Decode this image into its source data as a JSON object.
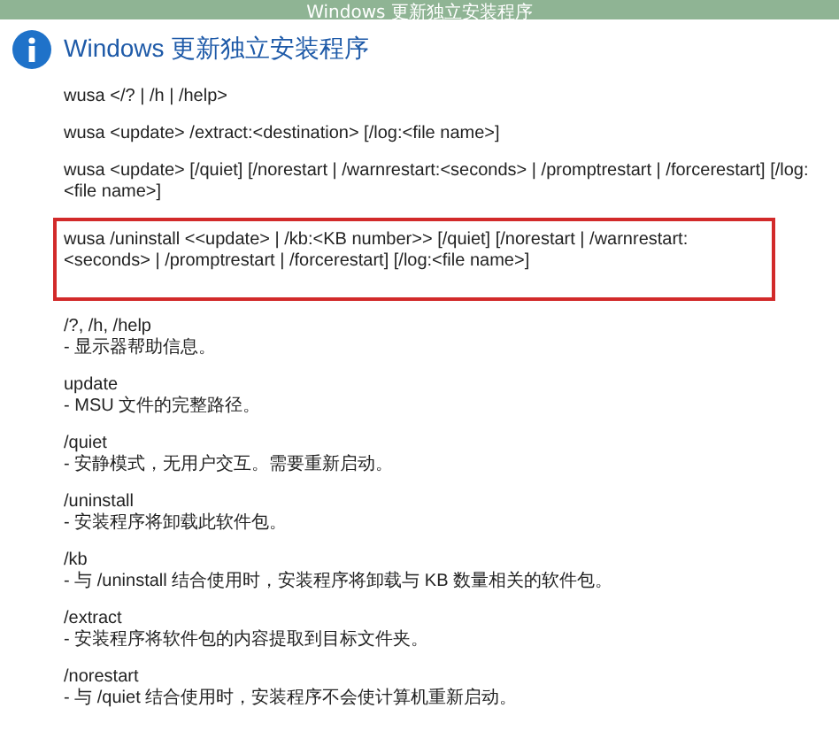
{
  "window": {
    "title": "Windows 更新独立安装程序"
  },
  "heading": "Windows 更新独立安装程序",
  "commands": [
    {
      "text": "wusa </? | /h | /help>",
      "highlighted": false
    },
    {
      "text": "wusa <update> /extract:<destination> [/log:<file name>]",
      "highlighted": false
    },
    {
      "text": "wusa <update> [/quiet] [/norestart | /warnrestart:<seconds> | /promptrestart | /forcerestart] [/log:<file name>]",
      "highlighted": false
    },
    {
      "text": "wusa /uninstall <<update> | /kb:<KB number>> [/quiet] [/norestart | /warnrestart:<seconds> | /promptrestart | /forcerestart] [/log:<file name>]",
      "highlighted": true
    }
  ],
  "options": [
    {
      "name": "/?, /h, /help",
      "description": "-  显示器帮助信息。"
    },
    {
      "name": "update",
      "description": "-  MSU 文件的完整路径。"
    },
    {
      "name": "/quiet",
      "description": "-  安静模式，无用户交互。需要重新启动。"
    },
    {
      "name": "/uninstall",
      "description": "-  安装程序将卸载此软件包。"
    },
    {
      "name": "/kb",
      "description": "-  与 /uninstall 结合使用时，安装程序将卸载与 KB 数量相关的软件包。"
    },
    {
      "name": "/extract",
      "description": "-  安装程序将软件包的内容提取到目标文件夹。"
    },
    {
      "name": "/norestart",
      "description": "-  与 /quiet 结合使用时，安装程序不会使计算机重新启动。"
    }
  ]
}
